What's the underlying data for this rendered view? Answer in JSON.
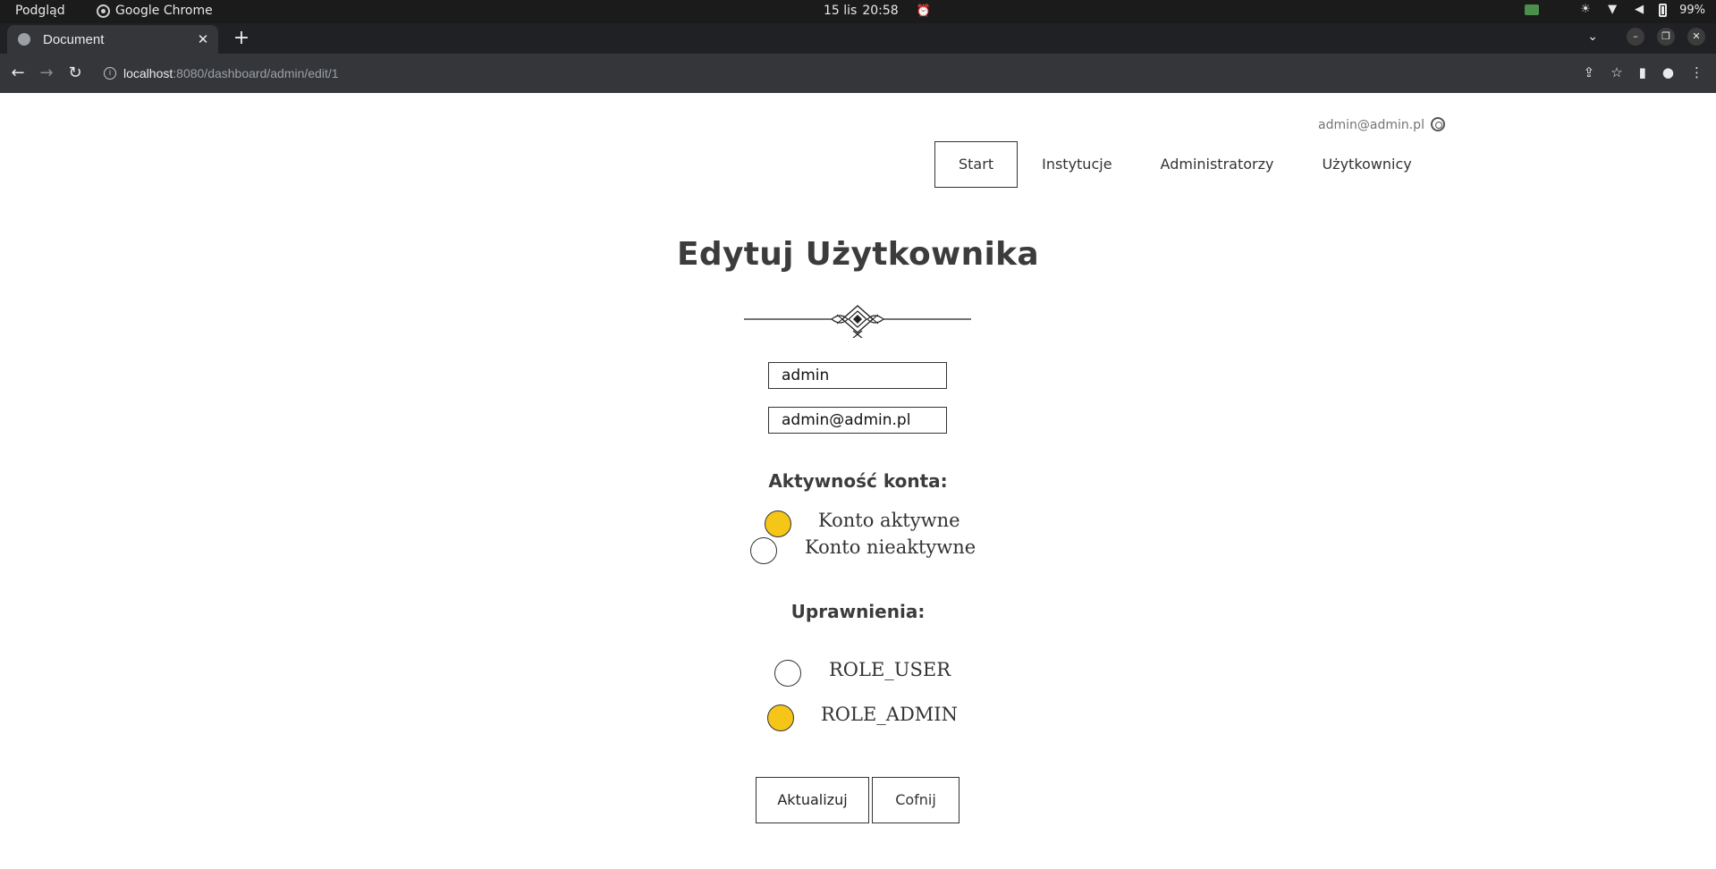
{
  "os": {
    "app_menu": "Podgląd",
    "active_app": "Google Chrome",
    "date": "15 lis",
    "time": "20:58",
    "battery": "99%"
  },
  "browser": {
    "tab_title": "Document",
    "url_host": "localhost",
    "url_path": ":8080/dashboard/admin/edit/1"
  },
  "header": {
    "user_email": "admin@admin.pl",
    "nav": [
      {
        "label": "Start",
        "active": true
      },
      {
        "label": "Instytucje"
      },
      {
        "label": "Administratorzy"
      },
      {
        "label": "Użytkownicy"
      }
    ]
  },
  "form": {
    "title": "Edytuj Użytkownika",
    "login_value": "admin",
    "email_value": "admin@admin.pl",
    "activity_label": "Aktywność konta:",
    "activity_options": [
      {
        "label": "Konto aktywne",
        "checked": true
      },
      {
        "label": "Konto nieaktywne",
        "checked": false
      }
    ],
    "roles_label": "Uprawnienia:",
    "role_options": [
      {
        "label": "ROLE_USER",
        "checked": false
      },
      {
        "label": "ROLE_ADMIN",
        "checked": true
      }
    ],
    "submit_label": "Aktualizuj",
    "back_label": "Cofnij"
  },
  "colors": {
    "radio_checked": "#f5c518",
    "border": "#333333"
  }
}
